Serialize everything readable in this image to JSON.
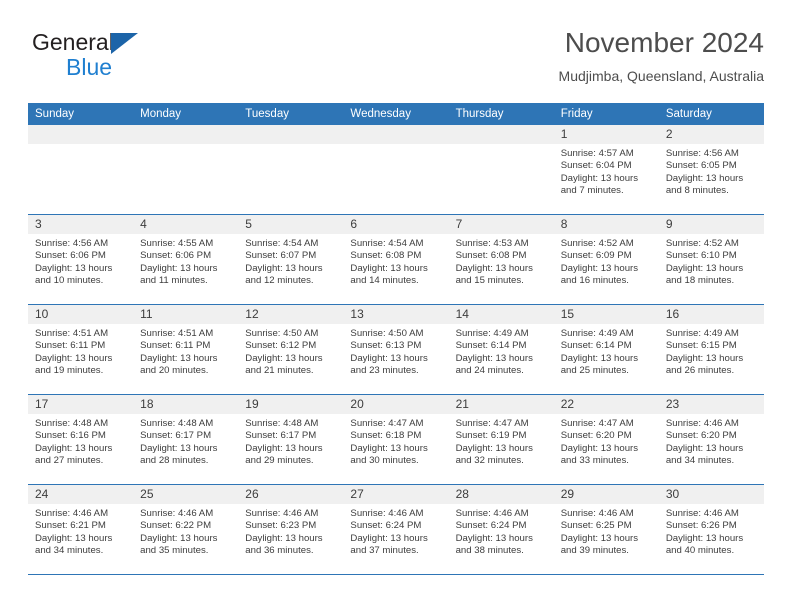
{
  "brand": {
    "name_part1": "General",
    "name_part2": "Blue",
    "logo_icon": "blue-triangle-icon"
  },
  "header": {
    "title": "November 2024",
    "location": "Mudjimba, Queensland, Australia"
  },
  "calendar": {
    "weekday_headers": [
      "Sunday",
      "Monday",
      "Tuesday",
      "Wednesday",
      "Thursday",
      "Friday",
      "Saturday"
    ],
    "accent_color": "#2e75b6",
    "daynum_band_color": "#f0f0f0",
    "weeks": [
      [
        {
          "day": "",
          "empty": true
        },
        {
          "day": "",
          "empty": true
        },
        {
          "day": "",
          "empty": true
        },
        {
          "day": "",
          "empty": true
        },
        {
          "day": "",
          "empty": true
        },
        {
          "day": "1",
          "sunrise": "Sunrise: 4:57 AM",
          "sunset": "Sunset: 6:04 PM",
          "daylight": "Daylight: 13 hours and 7 minutes."
        },
        {
          "day": "2",
          "sunrise": "Sunrise: 4:56 AM",
          "sunset": "Sunset: 6:05 PM",
          "daylight": "Daylight: 13 hours and 8 minutes."
        }
      ],
      [
        {
          "day": "3",
          "sunrise": "Sunrise: 4:56 AM",
          "sunset": "Sunset: 6:06 PM",
          "daylight": "Daylight: 13 hours and 10 minutes."
        },
        {
          "day": "4",
          "sunrise": "Sunrise: 4:55 AM",
          "sunset": "Sunset: 6:06 PM",
          "daylight": "Daylight: 13 hours and 11 minutes."
        },
        {
          "day": "5",
          "sunrise": "Sunrise: 4:54 AM",
          "sunset": "Sunset: 6:07 PM",
          "daylight": "Daylight: 13 hours and 12 minutes."
        },
        {
          "day": "6",
          "sunrise": "Sunrise: 4:54 AM",
          "sunset": "Sunset: 6:08 PM",
          "daylight": "Daylight: 13 hours and 14 minutes."
        },
        {
          "day": "7",
          "sunrise": "Sunrise: 4:53 AM",
          "sunset": "Sunset: 6:08 PM",
          "daylight": "Daylight: 13 hours and 15 minutes."
        },
        {
          "day": "8",
          "sunrise": "Sunrise: 4:52 AM",
          "sunset": "Sunset: 6:09 PM",
          "daylight": "Daylight: 13 hours and 16 minutes."
        },
        {
          "day": "9",
          "sunrise": "Sunrise: 4:52 AM",
          "sunset": "Sunset: 6:10 PM",
          "daylight": "Daylight: 13 hours and 18 minutes."
        }
      ],
      [
        {
          "day": "10",
          "sunrise": "Sunrise: 4:51 AM",
          "sunset": "Sunset: 6:11 PM",
          "daylight": "Daylight: 13 hours and 19 minutes."
        },
        {
          "day": "11",
          "sunrise": "Sunrise: 4:51 AM",
          "sunset": "Sunset: 6:11 PM",
          "daylight": "Daylight: 13 hours and 20 minutes."
        },
        {
          "day": "12",
          "sunrise": "Sunrise: 4:50 AM",
          "sunset": "Sunset: 6:12 PM",
          "daylight": "Daylight: 13 hours and 21 minutes."
        },
        {
          "day": "13",
          "sunrise": "Sunrise: 4:50 AM",
          "sunset": "Sunset: 6:13 PM",
          "daylight": "Daylight: 13 hours and 23 minutes."
        },
        {
          "day": "14",
          "sunrise": "Sunrise: 4:49 AM",
          "sunset": "Sunset: 6:14 PM",
          "daylight": "Daylight: 13 hours and 24 minutes."
        },
        {
          "day": "15",
          "sunrise": "Sunrise: 4:49 AM",
          "sunset": "Sunset: 6:14 PM",
          "daylight": "Daylight: 13 hours and 25 minutes."
        },
        {
          "day": "16",
          "sunrise": "Sunrise: 4:49 AM",
          "sunset": "Sunset: 6:15 PM",
          "daylight": "Daylight: 13 hours and 26 minutes."
        }
      ],
      [
        {
          "day": "17",
          "sunrise": "Sunrise: 4:48 AM",
          "sunset": "Sunset: 6:16 PM",
          "daylight": "Daylight: 13 hours and 27 minutes."
        },
        {
          "day": "18",
          "sunrise": "Sunrise: 4:48 AM",
          "sunset": "Sunset: 6:17 PM",
          "daylight": "Daylight: 13 hours and 28 minutes."
        },
        {
          "day": "19",
          "sunrise": "Sunrise: 4:48 AM",
          "sunset": "Sunset: 6:17 PM",
          "daylight": "Daylight: 13 hours and 29 minutes."
        },
        {
          "day": "20",
          "sunrise": "Sunrise: 4:47 AM",
          "sunset": "Sunset: 6:18 PM",
          "daylight": "Daylight: 13 hours and 30 minutes."
        },
        {
          "day": "21",
          "sunrise": "Sunrise: 4:47 AM",
          "sunset": "Sunset: 6:19 PM",
          "daylight": "Daylight: 13 hours and 32 minutes."
        },
        {
          "day": "22",
          "sunrise": "Sunrise: 4:47 AM",
          "sunset": "Sunset: 6:20 PM",
          "daylight": "Daylight: 13 hours and 33 minutes."
        },
        {
          "day": "23",
          "sunrise": "Sunrise: 4:46 AM",
          "sunset": "Sunset: 6:20 PM",
          "daylight": "Daylight: 13 hours and 34 minutes."
        }
      ],
      [
        {
          "day": "24",
          "sunrise": "Sunrise: 4:46 AM",
          "sunset": "Sunset: 6:21 PM",
          "daylight": "Daylight: 13 hours and 34 minutes."
        },
        {
          "day": "25",
          "sunrise": "Sunrise: 4:46 AM",
          "sunset": "Sunset: 6:22 PM",
          "daylight": "Daylight: 13 hours and 35 minutes."
        },
        {
          "day": "26",
          "sunrise": "Sunrise: 4:46 AM",
          "sunset": "Sunset: 6:23 PM",
          "daylight": "Daylight: 13 hours and 36 minutes."
        },
        {
          "day": "27",
          "sunrise": "Sunrise: 4:46 AM",
          "sunset": "Sunset: 6:24 PM",
          "daylight": "Daylight: 13 hours and 37 minutes."
        },
        {
          "day": "28",
          "sunrise": "Sunrise: 4:46 AM",
          "sunset": "Sunset: 6:24 PM",
          "daylight": "Daylight: 13 hours and 38 minutes."
        },
        {
          "day": "29",
          "sunrise": "Sunrise: 4:46 AM",
          "sunset": "Sunset: 6:25 PM",
          "daylight": "Daylight: 13 hours and 39 minutes."
        },
        {
          "day": "30",
          "sunrise": "Sunrise: 4:46 AM",
          "sunset": "Sunset: 6:26 PM",
          "daylight": "Daylight: 13 hours and 40 minutes."
        }
      ]
    ]
  }
}
